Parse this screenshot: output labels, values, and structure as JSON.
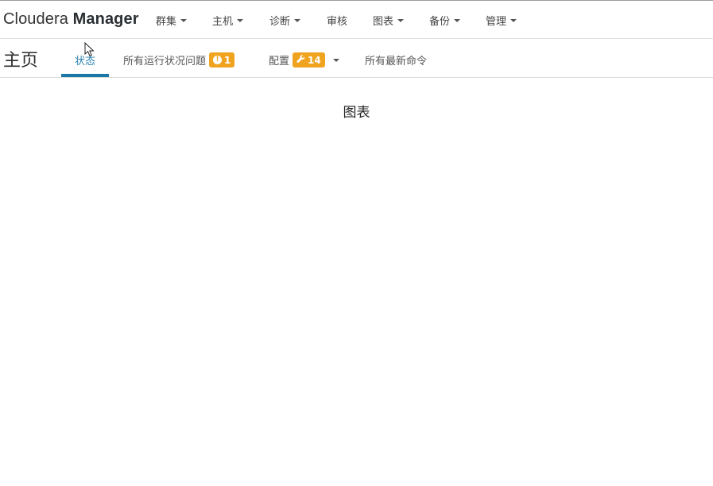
{
  "brand": {
    "light": "Cloudera",
    "bold": "Manager"
  },
  "topnav": {
    "items": [
      {
        "label": "群集",
        "dropdown": true
      },
      {
        "label": "主机",
        "dropdown": true
      },
      {
        "label": "诊断",
        "dropdown": true
      },
      {
        "label": "审核",
        "dropdown": false
      },
      {
        "label": "图表",
        "dropdown": true
      },
      {
        "label": "备份",
        "dropdown": true
      },
      {
        "label": "管理",
        "dropdown": true
      }
    ]
  },
  "page": {
    "title": "主页"
  },
  "tabs": {
    "status": "状态",
    "health_issues": "所有运行状况问题",
    "health_issues_count": "1",
    "config": "配置",
    "config_count": "14",
    "recent_commands": "所有最新命令"
  },
  "main": {
    "section_title": "图表"
  },
  "colors": {
    "accent": "#1a78a8",
    "badge": "#f0a31f"
  }
}
